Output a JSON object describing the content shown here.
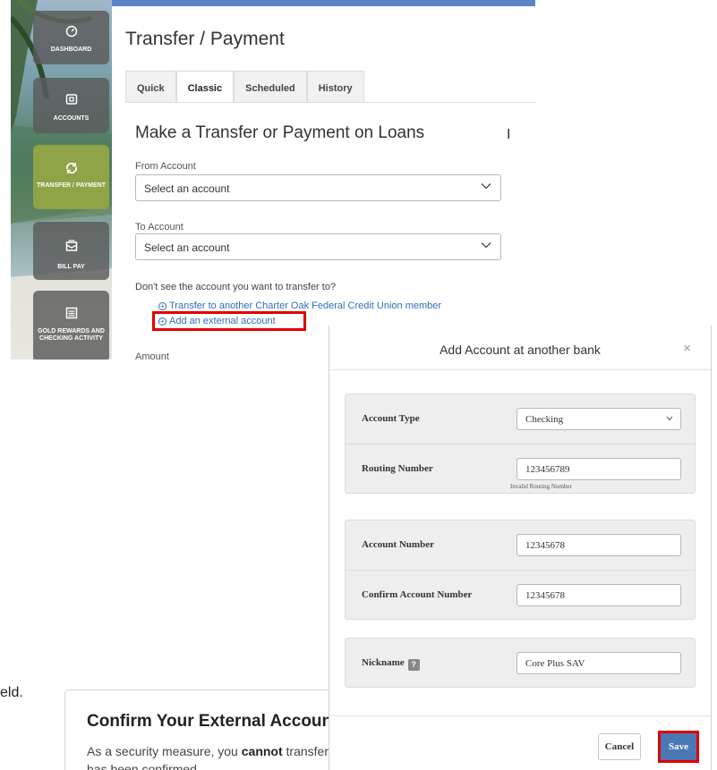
{
  "nav": {
    "items": [
      {
        "label": "DASHBOARD",
        "icon": "dashboard-gauge-icon"
      },
      {
        "label": "ACCOUNTS",
        "icon": "wallet-icon"
      },
      {
        "label": "TRANSFER / PAYMENT",
        "icon": "transfer-arrows-icon",
        "active": true
      },
      {
        "label": "BILL PAY",
        "icon": "envelope-icon"
      },
      {
        "label": "GOLD REWARDS AND CHECKING ACTIVITY",
        "icon": "list-icon"
      }
    ],
    "active_color": "#8ea447"
  },
  "page": {
    "title": "Transfer / Payment",
    "tabs": [
      "Quick",
      "Classic",
      "Scheduled",
      "History"
    ],
    "active_tab": "Classic",
    "section_title": "Make a Transfer or Payment on Loans",
    "side_heading_fragment": "I",
    "from_label": "From Account",
    "from_value": "Select an account",
    "to_label": "To Account",
    "to_value": "Select an account",
    "hint": "Don't see the account you want to transfer to?",
    "link_member": "Transfer to another Charter Oak Federal Credit Union member",
    "link_external": "Add an external account",
    "amount_label": "Amount"
  },
  "modal": {
    "title": "Add Account at another bank",
    "close": "×",
    "account_type_label": "Account Type",
    "account_type_value": "Checking",
    "routing_label": "Routing Number",
    "routing_value": "123456789",
    "routing_error": "Invalid Routing Number",
    "account_number_label": "Account Number",
    "account_number_value": "12345678",
    "confirm_label": "Confirm Account Number",
    "confirm_value": "12345678",
    "nickname_label": "Nickname",
    "nickname_help": "?",
    "nickname_value": "Core Plus SAV",
    "cancel": "Cancel",
    "save": "Save",
    "save_color": "#4a78b5",
    "highlight_color": "#e00000"
  },
  "background": {
    "stray_text": "eld.",
    "confirm_title": "Confirm Your External Account",
    "confirm_text_a": "As a security measure, you ",
    "confirm_text_bold": "cannot",
    "confirm_text_b": " transfer funds to or from this account until it has been confirmed."
  }
}
